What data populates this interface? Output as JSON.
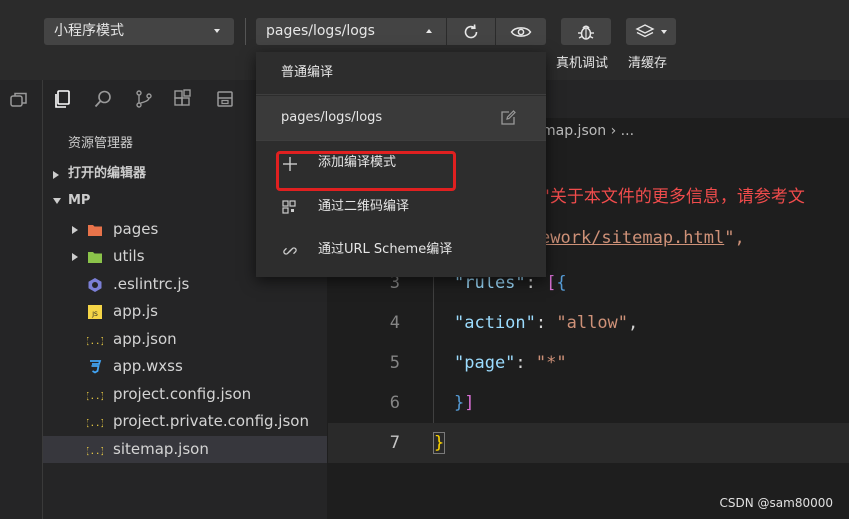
{
  "toolbar": {
    "mode_select": "小程序模式",
    "page_select": "pages/logs/logs",
    "debug_label": "真机调试",
    "cache_label": "清缓存"
  },
  "sidebar": {
    "title": "资源管理器",
    "sections": {
      "open_editors": "打开的编辑器",
      "project": "MP"
    },
    "tree": [
      {
        "label": "pages",
        "icon": "folder-pages-icon",
        "color": "#e8734a",
        "folder": true
      },
      {
        "label": "utils",
        "icon": "folder-utils-icon",
        "color": "#8bc34a",
        "folder": true
      },
      {
        "label": ".eslintrc.js",
        "icon": "eslint-icon",
        "color": "#7b7fd6"
      },
      {
        "label": "app.js",
        "icon": "js-icon",
        "color": "#f5d547"
      },
      {
        "label": "app.json",
        "icon": "json-icon",
        "color": "#f5d547"
      },
      {
        "label": "app.wxss",
        "icon": "css-icon",
        "color": "#42a5f5"
      },
      {
        "label": "project.config.json",
        "icon": "json-icon",
        "color": "#f5d547"
      },
      {
        "label": "project.private.config.json",
        "icon": "json-icon",
        "color": "#f5d547"
      },
      {
        "label": "sitemap.json",
        "icon": "json-icon",
        "color": "#f5d547",
        "selected": true
      }
    ]
  },
  "editor": {
    "breadcrumb": "map.json  ›  ...",
    "lines": {
      "l1_text": "\"关于本文件的更多信息，请参考文",
      "l2_link": "ework/sitemap.html",
      "l2_tail": "\",",
      "l3_no": "3",
      "l4_no": "4",
      "l5_no": "5",
      "l6_no": "6",
      "l7_no": "7",
      "rules_key": "\"rules\"",
      "action_key": "\"action\"",
      "action_val": "\"allow\"",
      "page_key": "\"page\"",
      "page_val": "\"*\""
    }
  },
  "dropdown": {
    "item_normal": "普通编译",
    "item_current": "pages/logs/logs",
    "item_add": "添加编译模式",
    "item_qrcode": "通过二维码编译",
    "item_url": "通过URL Scheme编译"
  },
  "watermark": "CSDN @sam80000",
  "colors": {
    "accent_red": "#e02020",
    "string": "#ce9178",
    "key": "#9cdcfe"
  }
}
